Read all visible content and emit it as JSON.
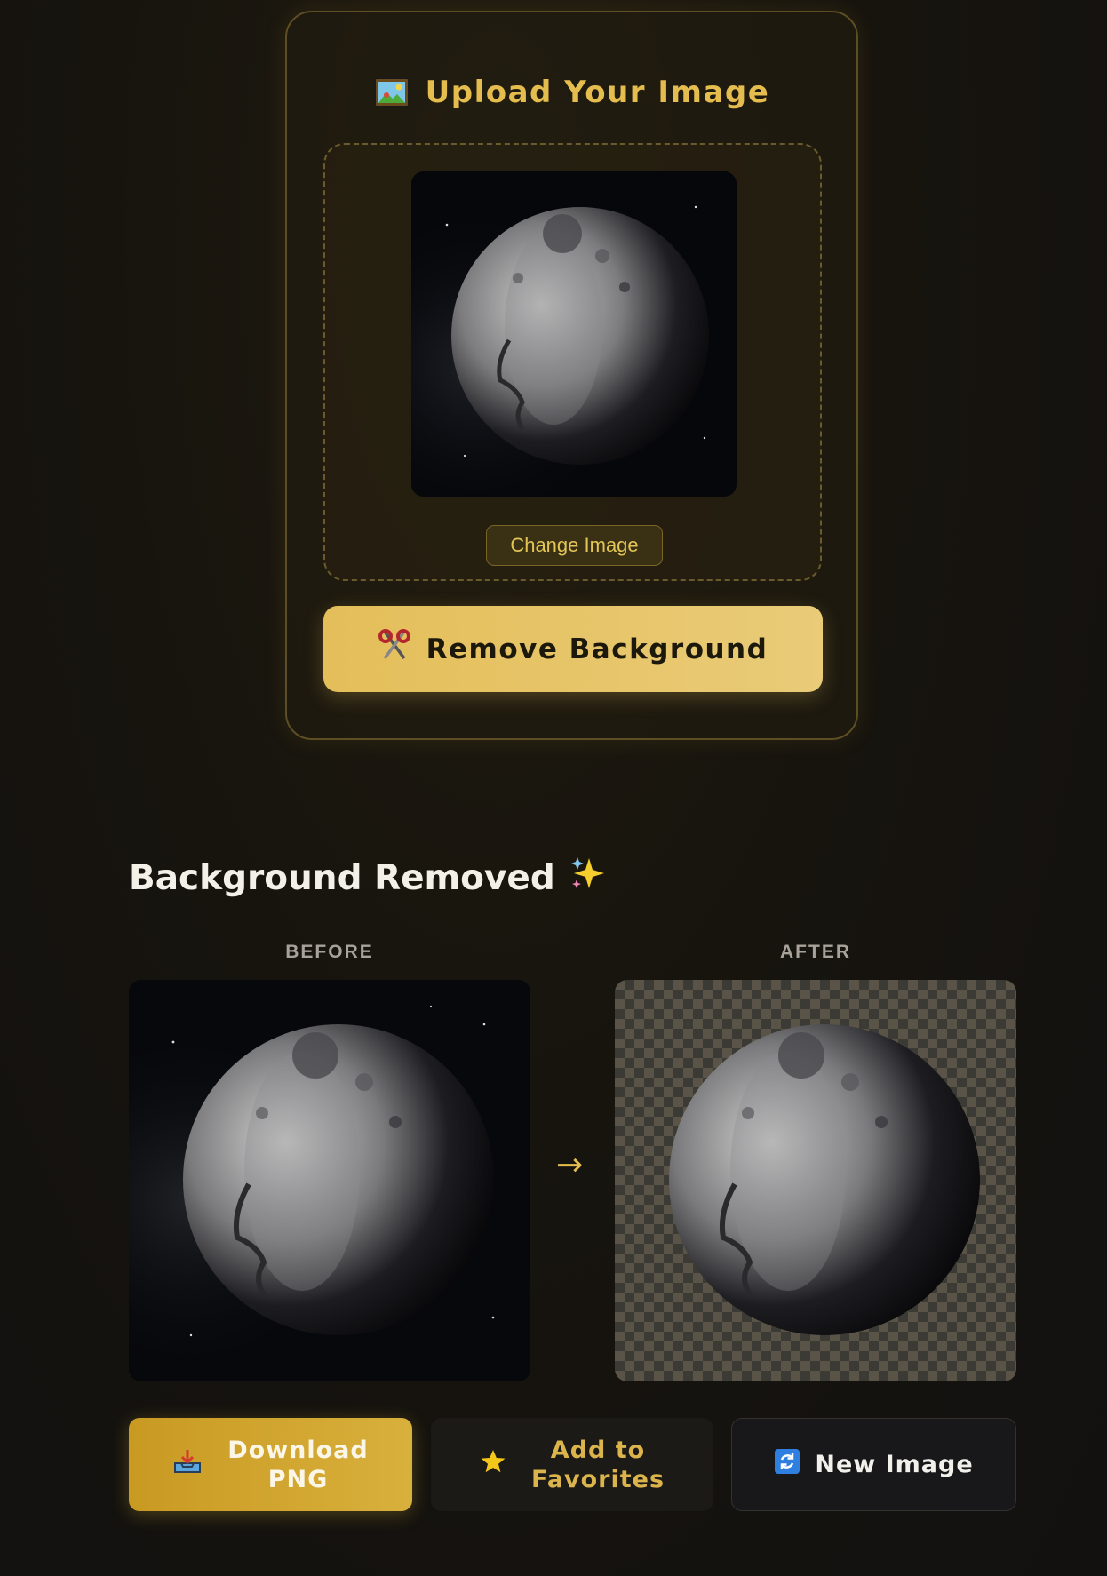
{
  "upload": {
    "title": "Upload Your Image",
    "title_icon": "framed-picture-icon",
    "preview_alt": "Moon face preview",
    "change_label": "Change Image",
    "remove_label": "Remove Background",
    "remove_icon": "scissors-icon"
  },
  "result": {
    "title": "Background Removed",
    "title_icon": "sparkles-icon",
    "before_label": "BEFORE",
    "after_label": "AFTER",
    "arrow": "→"
  },
  "actions": {
    "download_label_line1": "Download",
    "download_label_line2": "PNG",
    "download_icon": "inbox-tray-icon",
    "favorites_label_line1": "Add to",
    "favorites_label_line2": "Favorites",
    "favorites_icon": "star-icon",
    "new_label": "New Image",
    "new_icon": "refresh-icon"
  },
  "colors": {
    "accent": "#e4bd4e",
    "button_gold": "#e6c467",
    "download_gold": "#d0a530",
    "background": "#15130f"
  }
}
